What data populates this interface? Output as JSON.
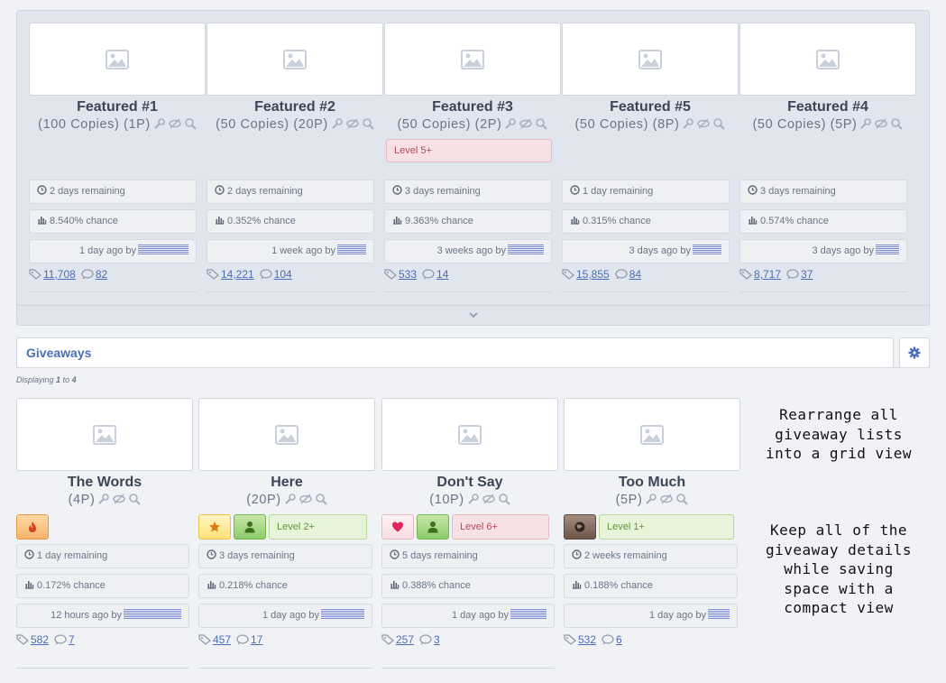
{
  "featured": {
    "cards": [
      {
        "title": "Featured #1",
        "meta": "(100 Copies) (1P)",
        "level": "",
        "remaining": "2 days remaining",
        "chance": "8.540% chance",
        "created": "1 day ago by",
        "entries": "11,708",
        "comments": "82"
      },
      {
        "title": "Featured #2",
        "meta": "(50 Copies) (20P)",
        "level": "",
        "remaining": "2 days remaining",
        "chance": "0.352% chance",
        "created": "1 week ago by",
        "entries": "14,221",
        "comments": "104"
      },
      {
        "title": "Featured #3",
        "meta": "(50 Copies) (2P)",
        "level": "Level 5+",
        "remaining": "3 days remaining",
        "chance": "9.363% chance",
        "created": "3 weeks ago by",
        "entries": "533",
        "comments": "14"
      },
      {
        "title": "Featured #5",
        "meta": "(50 Copies) (8P)",
        "level": "",
        "remaining": "1 day remaining",
        "chance": "0.315% chance",
        "created": "3 days ago by",
        "entries": "15,855",
        "comments": "84"
      },
      {
        "title": "Featured #4",
        "meta": "(50 Copies) (5P)",
        "level": "",
        "remaining": "3 days remaining",
        "chance": "0.574% chance",
        "created": "3 days ago by",
        "entries": "8,717",
        "comments": "37"
      }
    ]
  },
  "section": {
    "title": "Giveaways"
  },
  "pagination": {
    "prefix": "Displaying",
    "from": "1",
    "to_word": "to",
    "to": "4"
  },
  "giveaways": [
    {
      "title": "The Words",
      "meta": "(4P)",
      "badges": [
        {
          "kind": "orange",
          "icon": "fire-icon"
        }
      ],
      "remaining": "1 day remaining",
      "chance": "0.172% chance",
      "created": "12 hours ago by",
      "entries": "582",
      "comments": "7"
    },
    {
      "title": "Here",
      "meta": "(20P)",
      "badges": [
        {
          "kind": "yellow",
          "icon": "star-icon"
        },
        {
          "kind": "green",
          "icon": "user-icon"
        }
      ],
      "level": "Level 2+",
      "remaining": "3 days remaining",
      "chance": "0.218% chance",
      "created": "1 day ago by",
      "entries": "457",
      "comments": "17"
    },
    {
      "title": "Don't Say",
      "meta": "(10P)",
      "badges": [
        {
          "kind": "pink",
          "icon": "heart-icon"
        },
        {
          "kind": "green",
          "icon": "user-icon"
        }
      ],
      "level": "Level 6+",
      "remaining": "5 days remaining",
      "chance": "0.388% chance",
      "created": "1 day ago by",
      "entries": "257",
      "comments": "3"
    },
    {
      "title": "Too Much",
      "meta": "(5P)",
      "badges": [
        {
          "kind": "brown",
          "icon": "globe-icon"
        }
      ],
      "level": "Level 1+",
      "remaining": "2 weeks remaining",
      "chance": "0.188% chance",
      "created": "1 day ago by",
      "entries": "532",
      "comments": "6"
    }
  ],
  "promo": {
    "line1": [
      "Rearrange all",
      "giveaway lists",
      "into a grid view"
    ],
    "line2": [
      "Keep all of the",
      "giveaway details",
      "while saving",
      "space with a",
      "compact view"
    ]
  },
  "colors": {
    "accent": "#4a6db7",
    "panel": "#e1e5ed",
    "level_red_text": "#b34a5a",
    "level_green_text": "#5f9539"
  }
}
